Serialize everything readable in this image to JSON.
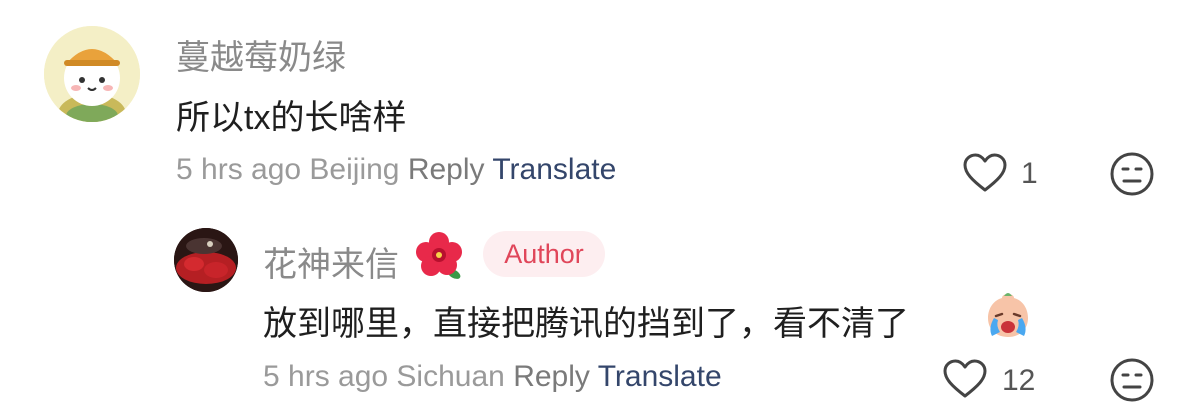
{
  "comments": [
    {
      "username": "蔓越莓奶绿",
      "text": "所以tx的长啥样",
      "time_location": "5 hrs ago Beijing",
      "reply_label": "Reply",
      "translate_label": "Translate",
      "like_count": "1"
    },
    {
      "username": "花神来信",
      "author_badge": "Author",
      "text": "放到哪里，直接把腾讯的挡到了，看不清了",
      "time_location": "5 hrs ago Sichuan",
      "reply_label": "Reply",
      "translate_label": "Translate",
      "like_count": "12"
    }
  ],
  "icons": [
    "heart-icon",
    "neutral-face-icon",
    "hibiscus-icon",
    "crying-emoji-icon"
  ],
  "colors": {
    "username": "#8a8a8a",
    "text": "#1f1f1f",
    "translate": "#34466b",
    "author_badge_bg": "#fdeef0",
    "author_badge_text": "#e0465a"
  }
}
